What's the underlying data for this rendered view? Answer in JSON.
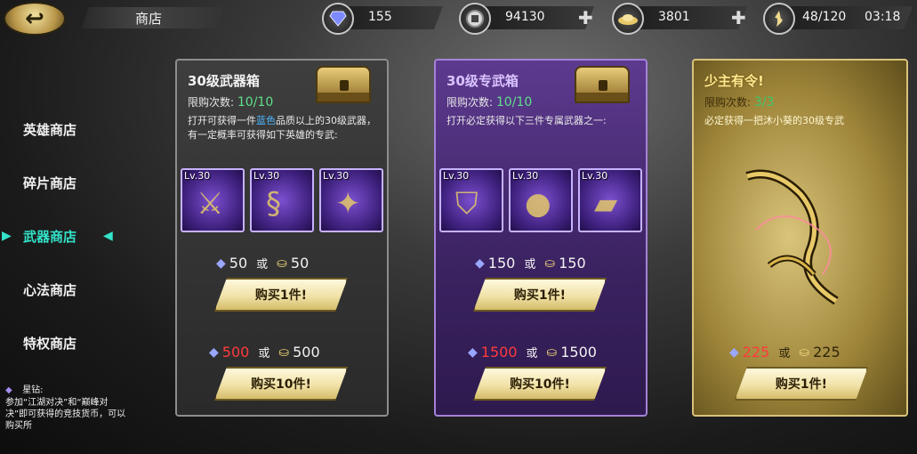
{
  "header": {
    "title": "商店",
    "resources": [
      {
        "icon": "diamond-icon",
        "value": "155",
        "has_plus": false
      },
      {
        "icon": "coin-icon",
        "value": "94130",
        "has_plus": true
      },
      {
        "icon": "gold-ingot-icon",
        "value": "3801",
        "has_plus": true
      },
      {
        "icon": "stamina-icon",
        "value": "48/120",
        "time": "03:18"
      }
    ]
  },
  "sidebar": {
    "items": [
      {
        "label": "英雄商店"
      },
      {
        "label": "碎片商店"
      },
      {
        "label": "武器商店",
        "active": true
      },
      {
        "label": "心法商店"
      },
      {
        "label": "特权商店"
      }
    ],
    "note_title": "星钻:",
    "note_text": "参加“江湖对决”和“巅峰对决”即可获得的竞技货币，可以购买所"
  },
  "cards": [
    {
      "title": "30级武器箱",
      "limit_label": "限购次数:",
      "limit_value": "10/10",
      "desc_pre": "打开可获得一件",
      "desc_highlight": "蓝色",
      "desc_post": "品质以上的30级武器，有一定概率可获得如下英雄的专武:",
      "items": [
        {
          "lv": "Lv.30"
        },
        {
          "lv": "Lv.30"
        },
        {
          "lv": "Lv.30"
        }
      ],
      "price1_gem": "50",
      "or": "或",
      "price1_ingot": "50",
      "buy1_label": "购买1件!",
      "price10_gem": "500",
      "price10_ingot": "500",
      "buy10_label": "购买10件!"
    },
    {
      "title": "30级专武箱",
      "limit_label": "限购次数:",
      "limit_value": "10/10",
      "desc": "打开必定获得以下三件专属武器之一:",
      "items": [
        {
          "lv": "Lv.30"
        },
        {
          "lv": "Lv.30"
        },
        {
          "lv": "Lv.30"
        }
      ],
      "price1_gem": "150",
      "or": "或",
      "price1_ingot": "150",
      "buy1_label": "购买1件!",
      "price10_gem": "1500",
      "price10_ingot": "1500",
      "buy10_label": "购买10件!"
    },
    {
      "title": "少主有令!",
      "limit_label": "限购次数:",
      "limit_value": "3/3",
      "desc": "必定获得一把沐小葵的30级专武",
      "price_gem": "225",
      "or": "或",
      "price_ingot": "225",
      "buy1_label": "购买1件!"
    }
  ],
  "colors": {
    "accent_active": "#33e3c9",
    "price_red": "#ff3b3b",
    "limit_green": "#5ee08a"
  }
}
